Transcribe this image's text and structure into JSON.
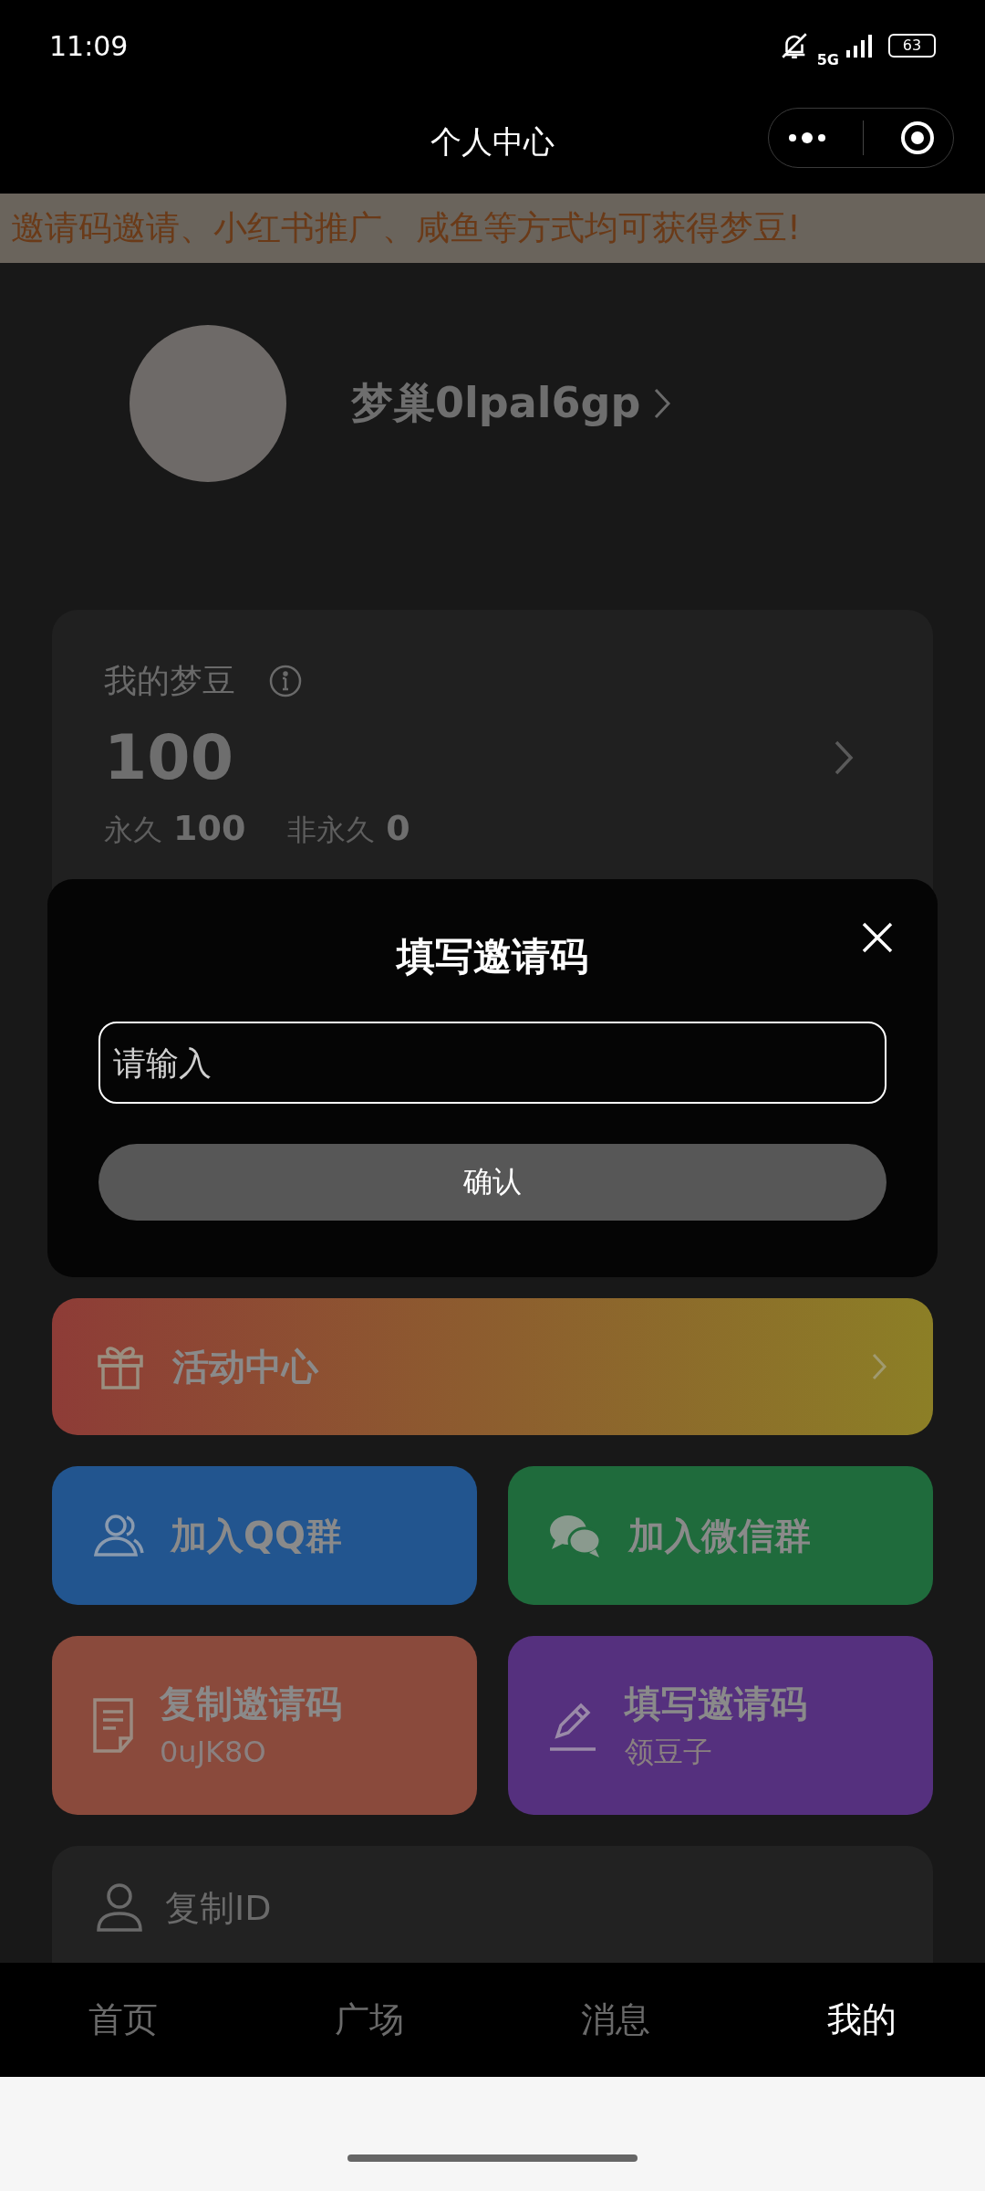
{
  "status_bar": {
    "time": "11:09",
    "network": "5G",
    "battery": "63"
  },
  "nav": {
    "title": "个人中心"
  },
  "banner": "邀请码邀请、小红书推广、咸鱼等方式均可获得梦豆!",
  "profile": {
    "name": "梦巢0lpal6gp"
  },
  "beans": {
    "label": "我的梦豆",
    "total": "100",
    "permanent_label": "永久",
    "permanent": "100",
    "temporary_label": "非永久",
    "temporary": "0"
  },
  "dialog": {
    "title": "填写邀请码",
    "placeholder": "请输入",
    "confirm": "确认"
  },
  "actions": [
    {
      "kind": "wide",
      "title": "活动中心"
    },
    {
      "kind": "tile",
      "title": "加入QQ群",
      "color": "#22558f"
    },
    {
      "kind": "tile",
      "title": "加入微信群",
      "color": "#1f6b3c"
    },
    {
      "kind": "tile",
      "title": "复制邀请码",
      "subtitle": "0uJK8O",
      "color": "#8a4a3c"
    },
    {
      "kind": "tile",
      "title": "填写邀请码",
      "subtitle": "领豆子",
      "color": "#55307e"
    }
  ],
  "menu": [
    {
      "label": "复制ID"
    }
  ],
  "tabs": [
    {
      "label": "首页",
      "selected": false
    },
    {
      "label": "广场",
      "selected": false
    },
    {
      "label": "消息",
      "selected": false
    },
    {
      "label": "我的",
      "selected": true
    }
  ]
}
